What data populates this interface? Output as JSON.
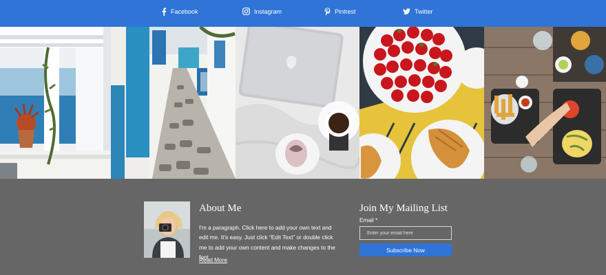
{
  "social": {
    "facebook": "Facebook",
    "instagram": "Instagram",
    "pinterest": "Pintrest",
    "twitter": "Twitter"
  },
  "gallery": {
    "images": [
      "santorini-terrace",
      "cobblestone-alley",
      "laptop-coffee-bed",
      "strawberries-croissants",
      "brunch-table"
    ]
  },
  "about": {
    "title": "About Me",
    "text": "I'm a paragraph. Click here to add your own text and edit me. It's easy. Just click “Edit Text” or double click me to add your own content and make changes to the font.",
    "read_more": "Read More"
  },
  "mailing": {
    "title": "Join My Mailing List",
    "email_label": "Email *",
    "email_placeholder": "Enter your email here",
    "email_value": "",
    "subscribe_label": "Subscribe Now"
  },
  "colors": {
    "accent": "#2f74d6",
    "footer_bg": "#666666"
  }
}
